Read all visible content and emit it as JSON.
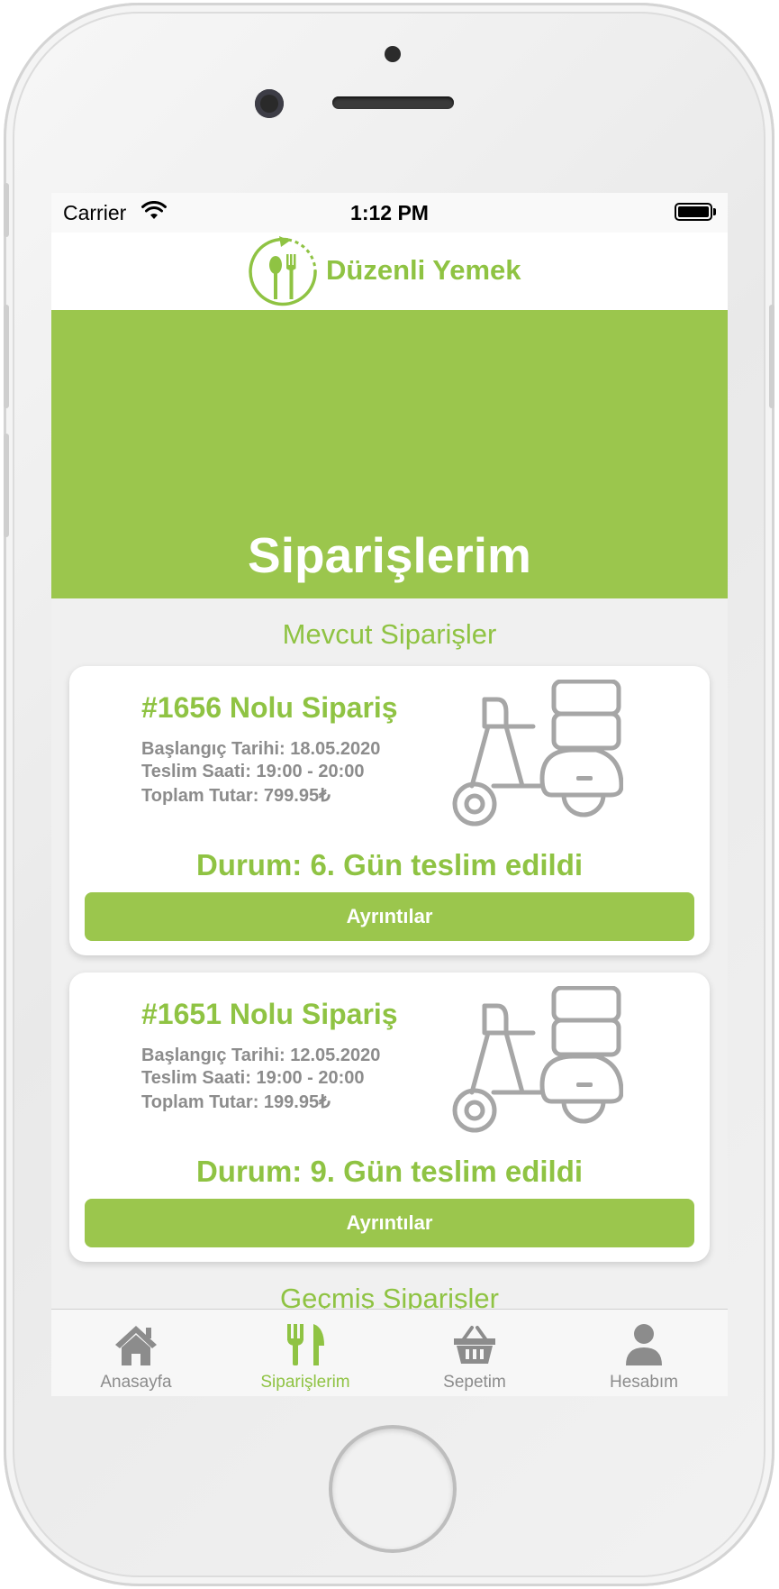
{
  "status_bar": {
    "carrier": "Carrier",
    "time": "1:12 PM"
  },
  "brand": {
    "name": "Düzenli Yemek",
    "accent_color": "#9bc64d"
  },
  "page": {
    "title": "Siparişlerim"
  },
  "sections": {
    "current": "Mevcut Siparişler",
    "past": "Geçmiş Siparişler"
  },
  "orders": [
    {
      "title": "#1656 Nolu Sipariş",
      "start_date": "Başlangıç Tarihi: 18.05.2020",
      "delivery_time": "Teslim Saati: 19:00 - 20:00",
      "total": "Toplam Tutar: 799.95₺",
      "status": "Durum: 6. Gün teslim edildi",
      "button": "Ayrıntılar",
      "icon": "scooter-icon"
    },
    {
      "title": "#1651 Nolu Sipariş",
      "start_date": "Başlangıç Tarihi: 12.05.2020",
      "delivery_time": "Teslim Saati: 19:00 - 20:00",
      "total": "Toplam Tutar: 199.95₺",
      "status": "Durum: 9. Gün teslim edildi",
      "button": "Ayrıntılar",
      "icon": "scooter-icon"
    }
  ],
  "tabbar": [
    {
      "label": "Anasayfa",
      "icon": "home-icon",
      "active": false
    },
    {
      "label": "Siparişlerim",
      "icon": "fork-knife-icon",
      "active": true
    },
    {
      "label": "Sepetim",
      "icon": "basket-icon",
      "active": false
    },
    {
      "label": "Hesabım",
      "icon": "user-icon",
      "active": false
    }
  ]
}
